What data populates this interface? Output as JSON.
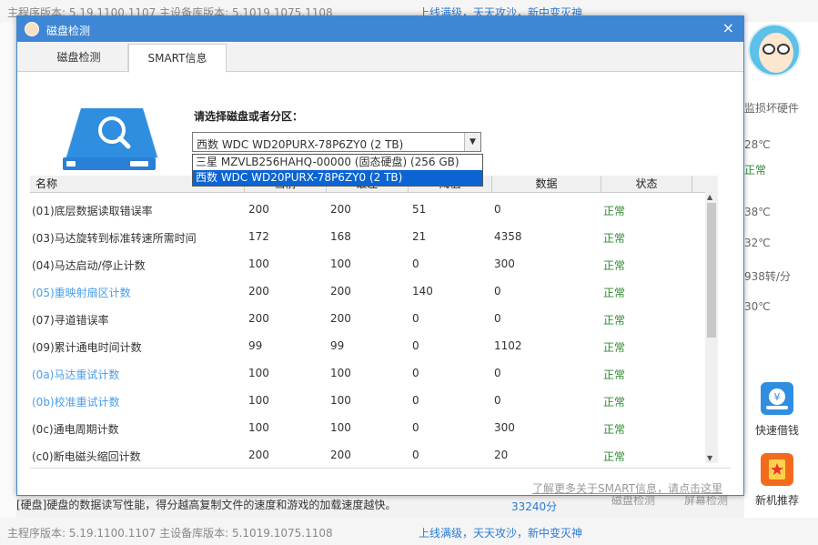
{
  "background": {
    "top_version": "主程序版本: 5.19.1100.1107    主设备库版本: 5.1019.1075.1108",
    "top_promo": "上线满级，天天攻沙，新中变灭神",
    "side_items": [
      {
        "label": "监损坏硬件"
      },
      {
        "label": "28℃"
      },
      {
        "label": "正常"
      },
      {
        "label": "38℃"
      },
      {
        "label": "32℃"
      },
      {
        "label": "938转/分"
      },
      {
        "label": "30℃"
      }
    ],
    "side_buttons": [
      {
        "label": "快速借钱",
        "icon": "money-icon"
      },
      {
        "label": "新机推荐",
        "icon": "badge-icon"
      }
    ],
    "bottom_text": "[硬盘]硬盘的数据读写性能，得分越高复制文件的速度和游戏的加载速度越快。",
    "bottom_score": "33240分",
    "bottom_tabs": [
      "磁盘检测",
      "屏幕检测"
    ],
    "bottom_version": "主程序版本: 5.19.1100.1107    主设备库版本: 5.1019.1075.1108",
    "bottom_promo": "上线满级，天天攻沙，新中变灭神"
  },
  "dialog": {
    "title": "磁盘检测",
    "close": "×",
    "tabs": [
      "磁盘检测",
      "SMART信息"
    ],
    "active_tab": "SMART信息",
    "select_label": "请选择磁盘或者分区：",
    "select_value": "西数 WDC WD20PURX-78P6ZY0  (2 TB)",
    "dropdown_options": [
      "三星  MZVLB256HAHQ-00000 (固态硬盘)  (256 GB)",
      "西数 WDC WD20PURX-78P6ZY0  (2 TB)"
    ],
    "columns": [
      "名称",
      "当前",
      "最差",
      "阈值",
      "数据",
      "状态"
    ],
    "rows": [
      {
        "name": "(01)底层数据读取错误率",
        "cur": "200",
        "worst": "200",
        "thr": "51",
        "data": "0",
        "status": "正常",
        "hl": false
      },
      {
        "name": "(03)马达旋转到标准转速所需时间",
        "cur": "172",
        "worst": "168",
        "thr": "21",
        "data": "4358",
        "status": "正常",
        "hl": false
      },
      {
        "name": "(04)马达启动/停止计数",
        "cur": "100",
        "worst": "100",
        "thr": "0",
        "data": "300",
        "status": "正常",
        "hl": false
      },
      {
        "name": "(05)重映射扇区计数",
        "cur": "200",
        "worst": "200",
        "thr": "140",
        "data": "0",
        "status": "正常",
        "hl": true
      },
      {
        "name": "(07)寻道错误率",
        "cur": "200",
        "worst": "200",
        "thr": "0",
        "data": "0",
        "status": "正常",
        "hl": false
      },
      {
        "name": "(09)累计通电时间计数",
        "cur": "99",
        "worst": "99",
        "thr": "0",
        "data": "1102",
        "status": "正常",
        "hl": false
      },
      {
        "name": "(0a)马达重试计数",
        "cur": "100",
        "worst": "100",
        "thr": "0",
        "data": "0",
        "status": "正常",
        "hl": true
      },
      {
        "name": "(0b)校准重试计数",
        "cur": "100",
        "worst": "100",
        "thr": "0",
        "data": "0",
        "status": "正常",
        "hl": true
      },
      {
        "name": "(0c)通电周期计数",
        "cur": "100",
        "worst": "100",
        "thr": "0",
        "data": "300",
        "status": "正常",
        "hl": false
      },
      {
        "name": "(c0)断电磁头缩回计数",
        "cur": "200",
        "worst": "200",
        "thr": "0",
        "data": "20",
        "status": "正常",
        "hl": false
      }
    ],
    "more_link": "了解更多关于SMART信息，请点击这里"
  },
  "colors": {
    "title_bar": "#3f87d4",
    "status_ok": "#2e8b2e",
    "highlight_name": "#4a9de8",
    "dropdown_selected": "#0a64d3"
  }
}
